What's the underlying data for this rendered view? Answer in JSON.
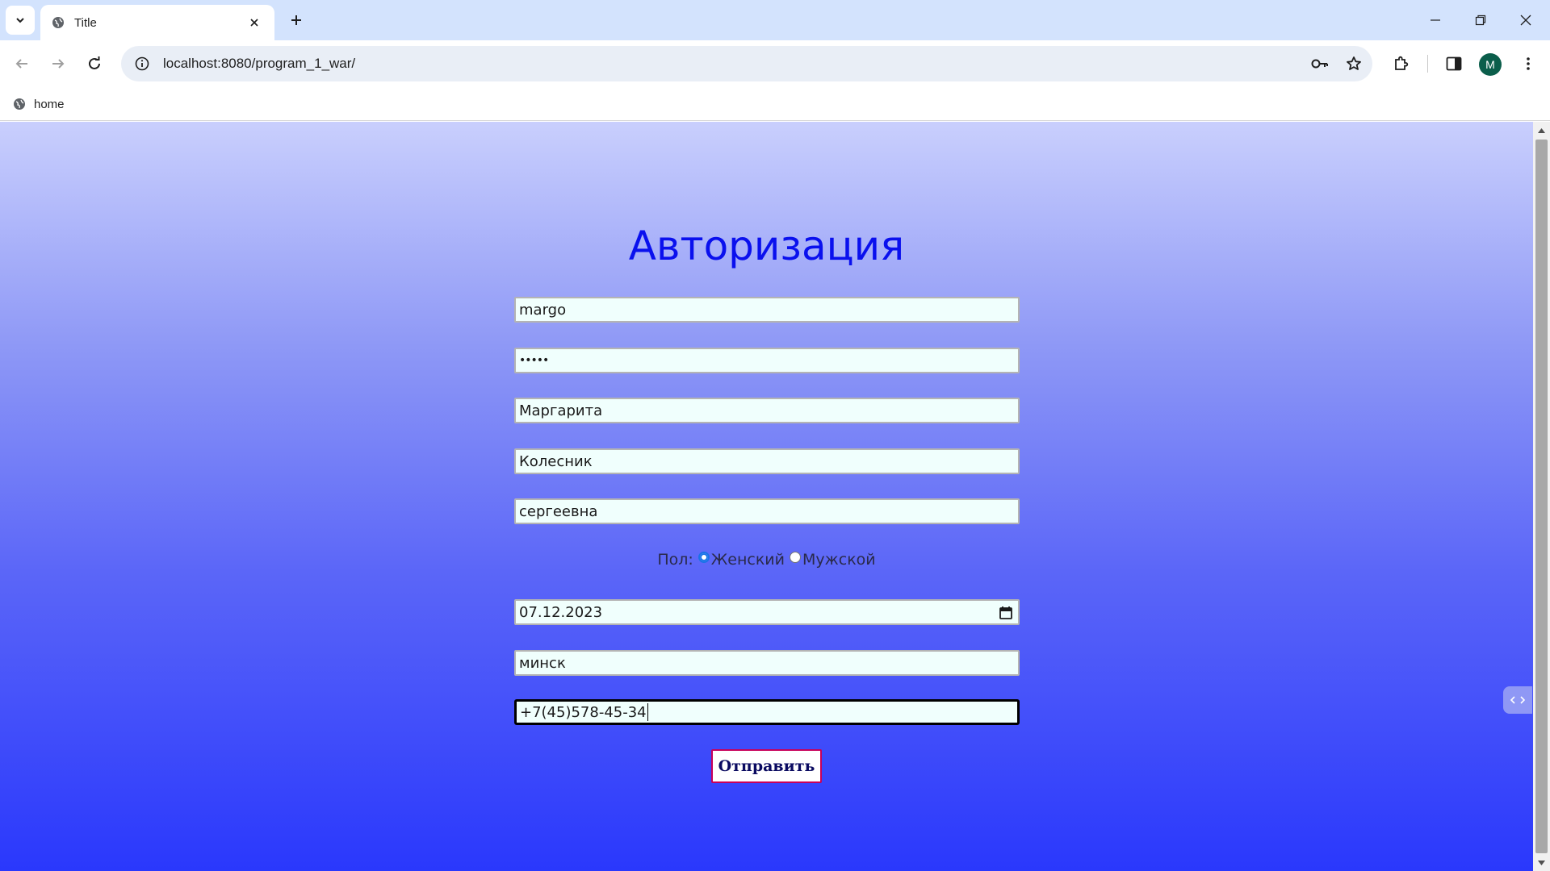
{
  "browser": {
    "tab_title": "Title",
    "url": "localhost:8080/program_1_war/",
    "profile_initial": "M",
    "bookmark_label": "home"
  },
  "form": {
    "title": "Авторизация",
    "login_value": "margo",
    "password_value": "•••••",
    "first_name_value": "Маргарита",
    "last_name_value": "Колесник",
    "patronymic_value": "сергеевна",
    "gender_label": "Пол:",
    "gender_female": "Женский",
    "gender_male": "Мужской",
    "gender_selected": "female",
    "birth_date_value": "07.12.2023",
    "city_value": "минск",
    "phone_value": "+7(45)578-45-34",
    "submit_label": "Отправить"
  },
  "colors": {
    "title": "#0a10ee",
    "field_bg": "#f0fffd",
    "submit_border": "#c8005a",
    "gradient_top": "#c9cffd",
    "gradient_bottom": "#2a38fc"
  }
}
